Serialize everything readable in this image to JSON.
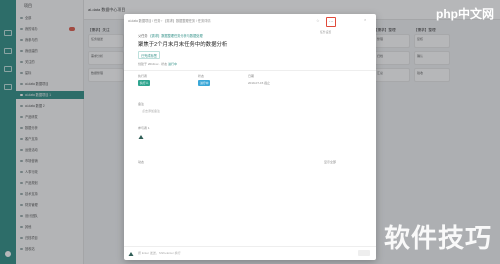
{
  "sidebar": {
    "logo": "项目",
    "items": [
      {
        "label": "全部",
        "active": false,
        "badge": false
      },
      {
        "label": "我的待办",
        "active": false,
        "badge": true
      },
      {
        "label": "我参与的",
        "active": false,
        "badge": false
      },
      {
        "label": "我创建的",
        "active": false,
        "badge": false
      },
      {
        "label": "关注的",
        "active": false,
        "badge": false
      },
      {
        "label": "星标",
        "active": false,
        "badge": false
      },
      {
        "label": "ai-data 数据项目",
        "active": false,
        "badge": false
      },
      {
        "label": "ai-data 数据项目 1",
        "active": true,
        "badge": false
      },
      {
        "label": "ai-data 数据 2",
        "active": false,
        "badge": false
      },
      {
        "label": "产品研发",
        "active": false,
        "badge": false
      },
      {
        "label": "数据分析",
        "active": false,
        "badge": false
      },
      {
        "label": "客户支持",
        "active": false,
        "badge": false
      },
      {
        "label": "运营活动",
        "active": false,
        "badge": false
      },
      {
        "label": "市场营销",
        "active": false,
        "badge": false
      },
      {
        "label": "人事行政",
        "active": false,
        "badge": false
      },
      {
        "label": "产品规划",
        "active": false,
        "badge": false
      },
      {
        "label": "技术支持",
        "active": false,
        "badge": false
      },
      {
        "label": "财务管理",
        "active": false,
        "badge": false
      },
      {
        "label": "设计团队",
        "active": false,
        "badge": false
      },
      {
        "label": "其他",
        "active": false,
        "badge": false
      },
      {
        "label": "归档项目",
        "active": false,
        "badge": false
      },
      {
        "label": "回收站",
        "active": false,
        "badge": false
      }
    ]
  },
  "topbar": {
    "title": "ai-data 数据中心项目"
  },
  "board": {
    "columns": [
      {
        "title": "【需求】关注",
        "cards": [
          "任务描述",
          "需求分析",
          "数据整理"
        ]
      },
      {
        "title": "【需求】数据",
        "cards": [
          "数据采集",
          "数据清洗",
          "数据治理"
        ]
      },
      {
        "title": "【需求】数据",
        "cards": [
          "数据分析",
          "建模",
          "报表"
        ]
      },
      {
        "title": "【需求】整理",
        "cards": [
          "整理",
          "归档",
          "汇总"
        ]
      },
      {
        "title": "【需求】整理",
        "cards": [
          "复核",
          "确认",
          "验收"
        ]
      }
    ]
  },
  "modal": {
    "breadcrumb": "ai-data 数据项目 / 任务 ›  【需求】数据整理任务 / 任务详情",
    "hint": "任务设置",
    "parent_label": "父任务",
    "parent_link": "【需求】数据整理任务分析与数据处理",
    "title": "聚焦于2个月末月末任务中的数据分析",
    "tag": "已完成标签",
    "meta_prefix": "创建于 2019-xx · 状态",
    "meta_status": "进行中",
    "fields": [
      {
        "label": "执行者",
        "value": "执行人",
        "color": "#2fa58f"
      },
      {
        "label": "状态",
        "value": "进行中",
        "color": "#3aa7d8"
      },
      {
        "label": "日期",
        "value": "2019-07-15 截止",
        "color": ""
      }
    ],
    "remarks_label": "备注",
    "remarks_value": "点击添加备注",
    "participants_label": "参与者 1",
    "activity_label": "动态",
    "activity_right": "显示全部",
    "comment_placeholder": "按 Enter 发送，Shift+Enter 换行",
    "close_icon": "×",
    "more_icon": "⋯",
    "star_icon": "☆"
  },
  "watermark": {
    "php": "php中文网",
    "tips": "软件技巧"
  },
  "colors": {
    "accent": "#2f8f86",
    "highlight": "#e04a3a"
  }
}
